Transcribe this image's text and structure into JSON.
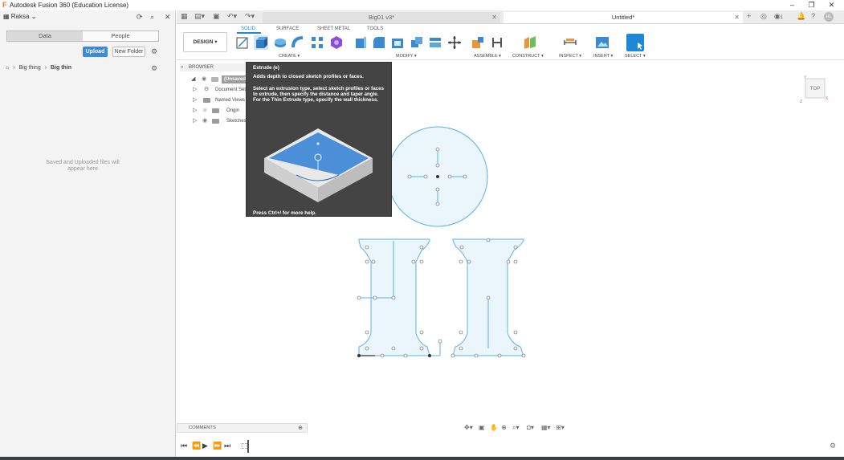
{
  "window": {
    "title": "Autodesk Fusion 360 (Education License)",
    "controls": {
      "minimize": "–",
      "restore": "❐",
      "close": "✕"
    }
  },
  "data_panel": {
    "team": "Raksa",
    "tabs": [
      {
        "label": "Data",
        "active": true
      },
      {
        "label": "People",
        "active": false
      }
    ],
    "upload_label": "Upload",
    "new_folder_label": "New Folder",
    "breadcrumb": [
      "Big thing",
      "Big thin"
    ],
    "empty_message": "Saved and Uploaded files will appear here"
  },
  "doc_tabs": [
    {
      "label": "Big01 v3*",
      "active": false
    },
    {
      "label": "Untitled*",
      "active": true
    }
  ],
  "notification_count": "1",
  "user_initials": "HL",
  "workspace": {
    "mode": "DESIGN",
    "tabs": [
      {
        "label": "SOLID",
        "active": true
      },
      {
        "label": "SURFACE",
        "active": false
      },
      {
        "label": "SHEET METAL",
        "active": false
      },
      {
        "label": "TOOLS",
        "active": false
      }
    ],
    "groups": [
      "CREATE",
      "MODIFY",
      "ASSEMBLE",
      "CONSTRUCT",
      "INSPECT",
      "INSERT",
      "SELECT"
    ]
  },
  "browser": {
    "title": "BROWSER",
    "items": [
      {
        "label": "(Unsaved)"
      },
      {
        "label": "Document Settings"
      },
      {
        "label": "Named Views"
      },
      {
        "label": "Origin"
      },
      {
        "label": "Sketches"
      }
    ]
  },
  "tooltip": {
    "title": "Extrude (e)",
    "description": "Adds depth to closed sketch profiles or faces.",
    "body": "Select an extrusion type, select sketch profiles or faces to extrude, then specify the distance and taper angle. For the Thin Extrude type, specify the wall thickness.",
    "footer": "Press Ctrl+/ for more help."
  },
  "viewcube": {
    "face": "TOP",
    "axes": {
      "x": "X",
      "y": "Y",
      "z": "Z"
    }
  },
  "comments_label": "COMMENTS",
  "colors": {
    "accent": "#1e88d4",
    "sketch": "#5bb3e6",
    "sketch_fill": "#eaf5fc",
    "tooltip_bg": "#444444"
  }
}
